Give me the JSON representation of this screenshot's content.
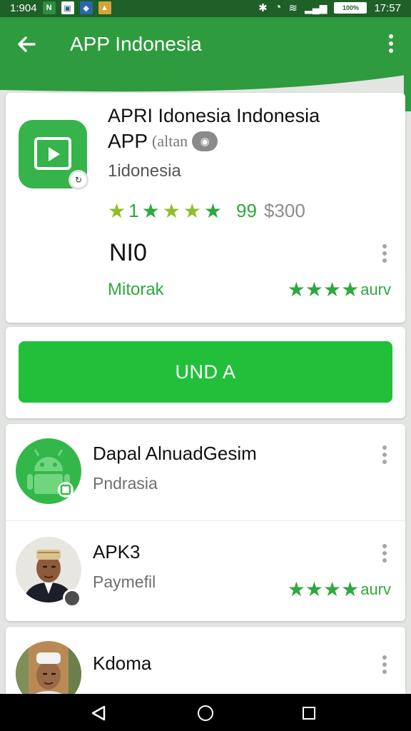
{
  "status_bar": {
    "time_left": "1:904",
    "time_right": "17:57",
    "battery_label": "100%",
    "left_icons": [
      "notification-icon-green",
      "notification-icon-gallery",
      "notification-icon-shield",
      "notification-icon-photo"
    ],
    "right_icons": [
      "bluetooth-icon",
      "alarm-icon",
      "wifi-icon",
      "signal-icon",
      "battery-icon"
    ]
  },
  "app_bar": {
    "title": "APP Indonesia",
    "back_icon": "arrow-left-icon",
    "menu_icon": "more-vert-icon",
    "color": "#2f9b3f"
  },
  "app_card": {
    "title": "APRI Idonesia Indonesia",
    "subtitle": "APP",
    "tag": "(altan",
    "developer": "1idonesia",
    "rating_value": "99",
    "price": "$300",
    "rating_stars_label": "1",
    "no_label": "NI0",
    "status_word": "Mitorak",
    "stars_text": "aurv",
    "accent": "#2fa83f"
  },
  "install": {
    "label": "UND A",
    "color": "#22c03a"
  },
  "list": {
    "items": [
      {
        "title": "Dapal AlnuadGesim",
        "subtitle": "Pndrasia",
        "avatar": "android-icon",
        "stars_text": ""
      },
      {
        "title": "APK3",
        "subtitle": "Paymefil",
        "avatar": "person-avatar",
        "stars_text": "aurv"
      },
      {
        "title": "Kdoma",
        "subtitle": "",
        "avatar": "person-avatar",
        "stars_text": ""
      }
    ]
  },
  "nav_bar": {
    "back_icon": "nav-back-icon",
    "home_icon": "nav-home-icon",
    "recents_icon": "nav-recents-icon"
  }
}
